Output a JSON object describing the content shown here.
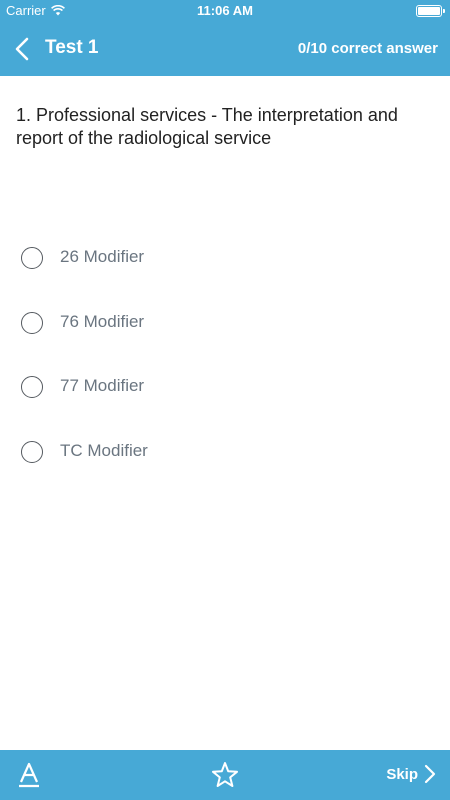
{
  "status_bar": {
    "carrier": "Carrier",
    "time": "11:06 AM",
    "wifi_icon": "wifi-icon",
    "battery_icon": "battery-icon"
  },
  "nav": {
    "back_icon": "chevron-left-icon",
    "title": "Test 1",
    "score": "0/10 correct answer"
  },
  "question": {
    "text": "1. Professional services - The interpretation and report of the radiological service"
  },
  "options": [
    {
      "label": "26 Modifier",
      "selected": false
    },
    {
      "label": "76 Modifier",
      "selected": false
    },
    {
      "label": "77 Modifier",
      "selected": false
    },
    {
      "label": "TC Modifier",
      "selected": false
    }
  ],
  "toolbar": {
    "font_icon": "font-size-icon",
    "bookmark_icon": "star-icon",
    "skip_label": "Skip",
    "skip_icon": "chevron-right-icon"
  },
  "colors": {
    "accent": "#47a9d6",
    "question_text": "#222222",
    "option_text": "#6a7580"
  }
}
